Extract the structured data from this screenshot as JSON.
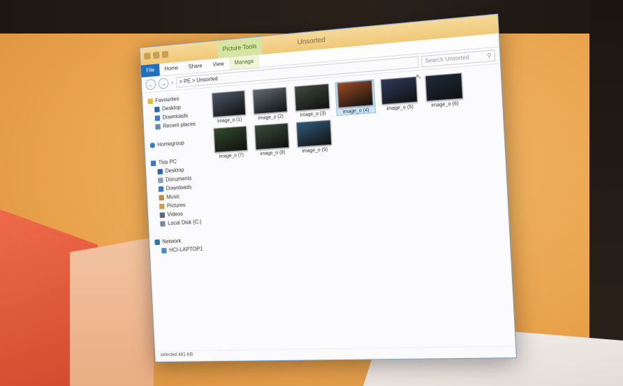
{
  "window": {
    "title": "Unsorted",
    "context_tab": "Picture Tools",
    "ribbon_tabs": [
      "File",
      "Home",
      "Share",
      "View",
      "Manage"
    ],
    "address_path": "> PE > Unsorted",
    "search_placeholder": "Search Unsorted",
    "status_text": "selected  481 KB"
  },
  "nav": {
    "favourites": {
      "label": "Favourites",
      "items": [
        "Desktop",
        "Downloads",
        "Recent places"
      ]
    },
    "homegroup": {
      "label": "Homegroup"
    },
    "thispc": {
      "label": "This PC",
      "items": [
        "Desktop",
        "Documents",
        "Downloads",
        "Music",
        "Pictures",
        "Videos",
        "Local Disk (C:)"
      ]
    },
    "network": {
      "label": "Network",
      "items": [
        "HCI-LAPTOP1"
      ]
    }
  },
  "files": [
    {
      "name": "image_o (1)",
      "color": "#4a5866"
    },
    {
      "name": "image_o (2)",
      "color": "#5f6a72"
    },
    {
      "name": "image_o (3)",
      "color": "#3e4a3a"
    },
    {
      "name": "image_o (4)",
      "color": "#9a4a22"
    },
    {
      "name": "image_o (5)",
      "color": "#2b3a5a"
    },
    {
      "name": "image_o (6)",
      "color": "#1b2a3a"
    },
    {
      "name": "image_o (7)",
      "color": "#2f4a2a"
    },
    {
      "name": "image_o (8)",
      "color": "#3a4a3a"
    },
    {
      "name": "image_o (9)",
      "color": "#2f5a7a"
    }
  ],
  "colors": {
    "file_tab": "#1f6fc2",
    "selection": "#cde6f7",
    "titlebar": "#f0c878"
  }
}
